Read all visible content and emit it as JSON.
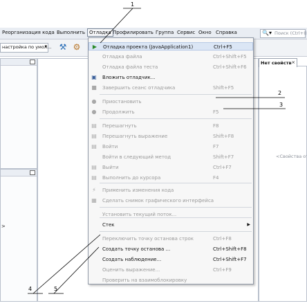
{
  "menubar": {
    "items": [
      "Реорганизация кода",
      "Выполнить",
      "Отладка",
      "Профилировать",
      "Группа",
      "Сервис",
      "Окно",
      "Справка"
    ],
    "search_placeholder": "Поиск (Ctrl+I)"
  },
  "toolbar": {
    "config": "настройка по умол..."
  },
  "properties_tab": "Нет свойств",
  "properties_hint": "<Свойства от",
  "left_marker": ">",
  "menu": {
    "items": [
      {
        "label": "Отладка проекта (JavaApplication1)",
        "shortcut": "Ctrl+F5",
        "icon": "debug-project-icon"
      },
      {
        "label": "Отладка файла",
        "shortcut": "Ctrl+Shift+F5"
      },
      {
        "label": "Отладка файла теста",
        "shortcut": "Ctrl+Shift+F6"
      },
      {
        "label": "Вложить отладчик...",
        "shortcut": "",
        "icon": "attach-debugger-icon"
      },
      {
        "label": "Завершить сеанс отладчика",
        "shortcut": "Shift+F5",
        "icon": "stop-icon"
      },
      {
        "label": "Приостановить",
        "shortcut": "",
        "icon": "pause-icon"
      },
      {
        "label": "Продолжить",
        "shortcut": "F5",
        "icon": "continue-icon"
      },
      {
        "label": "Перешагнуть",
        "shortcut": "F8",
        "icon": "step-over-icon"
      },
      {
        "label": "Перешагнуть выражение",
        "shortcut": "Shift+F8",
        "icon": "step-over-expression-icon"
      },
      {
        "label": "Войти",
        "shortcut": "F7",
        "icon": "step-into-icon"
      },
      {
        "label": "Войти в следующий метод",
        "shortcut": "Shift+F7"
      },
      {
        "label": "Выйти",
        "shortcut": "Ctrl+F7",
        "icon": "step-out-icon"
      },
      {
        "label": "Выполнить до курсора",
        "shortcut": "F4",
        "icon": "run-to-cursor-icon"
      },
      {
        "label": "Применить изменения кода",
        "shortcut": "",
        "icon": "apply-changes-icon"
      },
      {
        "label": "Сделать снимок графического интерфейса",
        "shortcut": "",
        "icon": "snapshot-icon"
      },
      {
        "label": "Установить текущий поток...",
        "shortcut": ""
      },
      {
        "label": "Стек",
        "shortcut": ""
      },
      {
        "label": "Переключить точку останова строк",
        "shortcut": "Ctrl+F8"
      },
      {
        "label": "Создать точку останова ...",
        "shortcut": "Ctrl+Shift+F8"
      },
      {
        "label": "Создать наблюдение...",
        "shortcut": "Ctrl+Shift+F7"
      },
      {
        "label": "Оценить выражение...",
        "shortcut": "Ctrl+F9"
      },
      {
        "label": "Проверить на взаимоблокировку",
        "shortcut": ""
      }
    ]
  },
  "callouts": [
    "1",
    "2",
    "3",
    "4",
    "5"
  ]
}
